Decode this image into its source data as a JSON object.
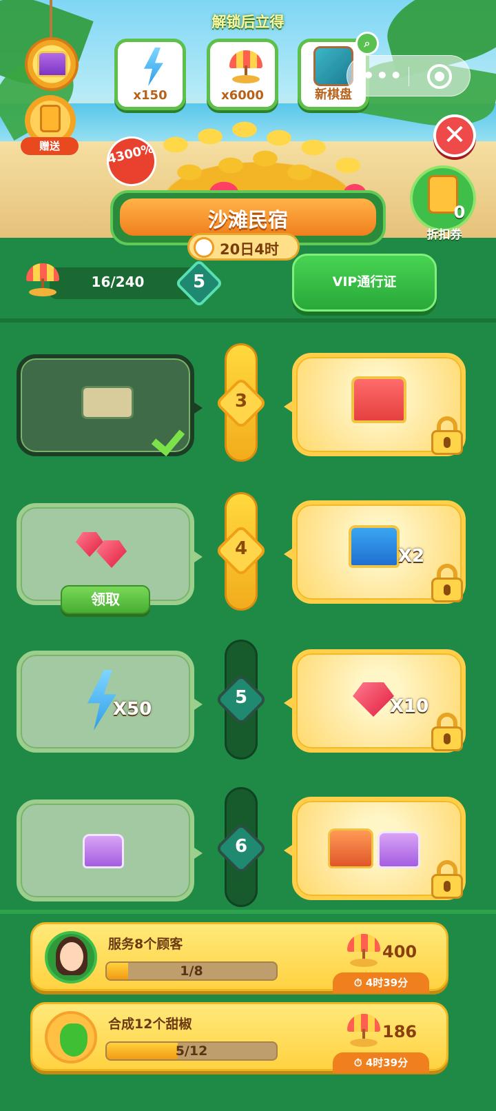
{
  "banner": {
    "unlock_title": "解锁后立得",
    "unlock_items": [
      {
        "icon": "lightning-icon",
        "label": "x150"
      },
      {
        "icon": "beach-umbrella-icon",
        "label": "x6000"
      },
      {
        "icon": "game-board-icon",
        "label": "新棋盘"
      }
    ],
    "gift_label": "赠送",
    "percent_badge": "4300%",
    "coupon_count": "0",
    "coupon_label": "折扣券"
  },
  "event": {
    "title": "沙滩民宿",
    "timer": "20日4时",
    "progress": "16/240",
    "level": "5",
    "vip_button": "VIP通行证"
  },
  "rows": [
    {
      "level": "3",
      "free_label": "",
      "vip_label": "",
      "free_state": "claimed"
    },
    {
      "level": "4",
      "free_label": "",
      "vip_label": "X2",
      "free_claim": "领取"
    },
    {
      "level": "5",
      "free_label": "X50",
      "vip_label": "X10"
    },
    {
      "level": "6",
      "free_label": "",
      "vip_label": ""
    }
  ],
  "tasks": [
    {
      "label": "服务8个顾客",
      "progress": "1/8",
      "progress_fraction": 0.125,
      "reward": "400",
      "time": "4时39分"
    },
    {
      "label": "合成12个甜椒",
      "progress": "5/12",
      "progress_fraction": 0.4167,
      "reward": "186",
      "time": "4时39分"
    }
  ],
  "colors": {
    "background": "#1f8a45",
    "gold": "#ffd241",
    "accent_green": "#3fbf4a",
    "close_red": "#ef4a4a"
  }
}
